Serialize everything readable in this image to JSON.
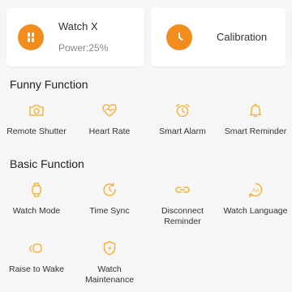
{
  "device_card": {
    "name": "Watch X",
    "power": "Power:25%",
    "icon": "watch-pause-icon"
  },
  "calibration_card": {
    "label": "Calibration",
    "icon": "clock-icon"
  },
  "accent_color": "#f28c1c",
  "icon_color": "#f5b53c",
  "funny_function": {
    "title": "Funny Function",
    "items": [
      {
        "label": "Remote Shutter",
        "icon": "camera-icon"
      },
      {
        "label": "Heart Rate",
        "icon": "heart-pulse-icon"
      },
      {
        "label": "Smart Alarm",
        "icon": "alarm-clock-icon"
      },
      {
        "label": "Smart Reminder",
        "icon": "bell-icon"
      }
    ]
  },
  "basic_function": {
    "title": "Basic Function",
    "items": [
      {
        "label": "Watch Mode",
        "icon": "watch-icon"
      },
      {
        "label": "Time Sync",
        "icon": "sync-clock-icon"
      },
      {
        "label": "Disconnect Reminder",
        "line1": "Disconnect",
        "line2": "Reminder",
        "icon": "broken-link-icon"
      },
      {
        "label": "Watch Language",
        "icon": "language-bubble-icon"
      },
      {
        "label": "Raise to Wake",
        "icon": "raise-wrist-icon"
      },
      {
        "label": "Watch Maintenance",
        "line1": "Watch",
        "line2": "Maintenance",
        "icon": "shield-bolt-icon"
      }
    ]
  }
}
